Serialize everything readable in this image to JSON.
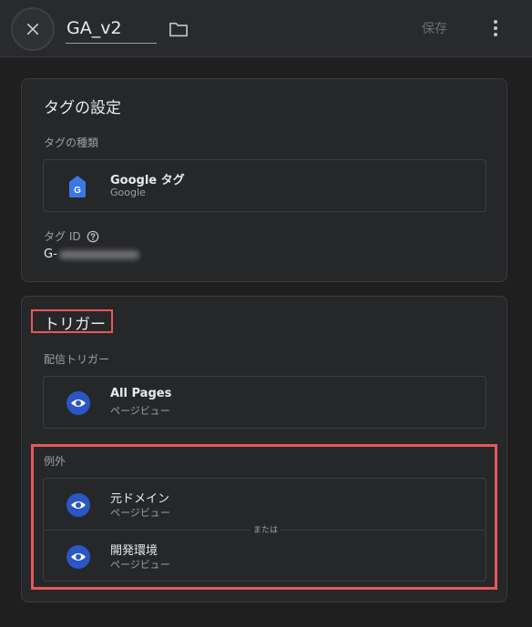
{
  "header": {
    "title": "GA_v2",
    "save_label": "保存"
  },
  "tag_config": {
    "heading": "タグの設定",
    "type_label": "タグの種類",
    "tag_type": {
      "name": "Google タグ",
      "sub": "Google"
    },
    "tag_id_label": "タグ ID",
    "tag_id_prefix": "G-"
  },
  "triggers": {
    "heading": "トリガー",
    "firing_label": "配信トリガー",
    "firing": [
      {
        "name": "All Pages",
        "sub": "ページビュー"
      }
    ],
    "exception_label": "例外",
    "exceptions": [
      {
        "name": "元ドメイン",
        "sub": "ページビュー"
      },
      {
        "name": "開発環境",
        "sub": "ページビュー"
      }
    ],
    "or_label": "または"
  },
  "colors": {
    "background": "#1f1f20",
    "card": "#262729",
    "highlight": "#e8575a",
    "icon_blue": "#2a56c6"
  },
  "icons": [
    "close-icon",
    "folder-icon",
    "more-vert-icon",
    "google-tag-icon",
    "help-icon",
    "eye-icon"
  ]
}
